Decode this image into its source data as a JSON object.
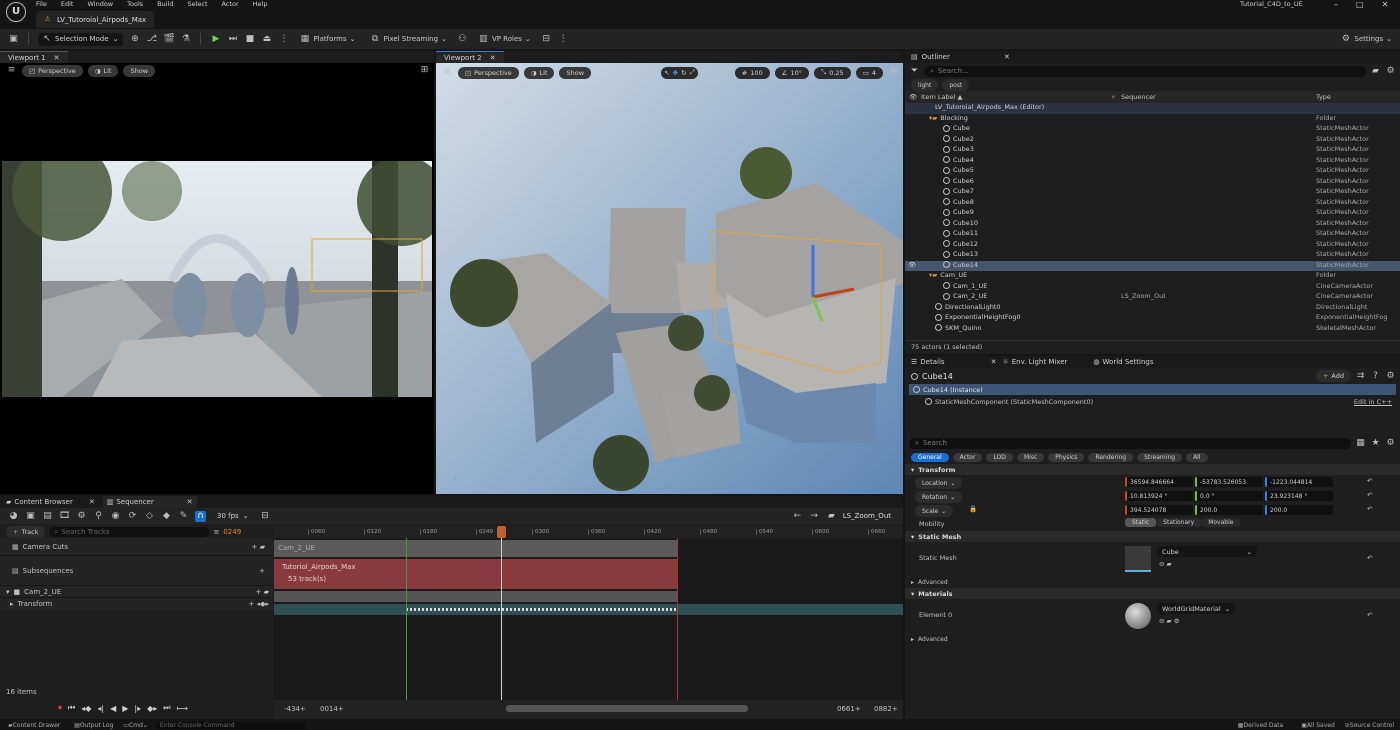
{
  "menu": [
    "File",
    "Edit",
    "Window",
    "Tools",
    "Build",
    "Select",
    "Actor",
    "Help"
  ],
  "level_tab": "LV_Tutoroial_Airpods_Max",
  "project_name": "Tutorial_C4D_to_UE",
  "toolbar": {
    "selection_mode": "Selection Mode",
    "platforms": "Platforms",
    "pixel_streaming": "Pixel Streaming",
    "vp_roles": "VP Roles",
    "settings": "Settings"
  },
  "viewport1": {
    "tab": "Viewport 1",
    "perspective": "Perspective",
    "lit": "Lit",
    "show": "Show"
  },
  "viewport2": {
    "tab": "Viewport 2",
    "perspective": "Perspective",
    "lit": "Lit",
    "show": "Show",
    "grid_size": "100",
    "rot_snap": "10°",
    "scale_snap": "0.25",
    "cam_speed": "4"
  },
  "outliner": {
    "tab": "Outliner",
    "search_placeholder": "Search...",
    "filters": [
      "light",
      "post"
    ],
    "col_label": "Item Label ▲",
    "col_seq": "Sequencer",
    "col_type": "Type",
    "root": "LV_Tutoroial_Airpods_Max (Editor)",
    "rows": [
      {
        "name": "Blocking",
        "type": "Folder",
        "indent": 1,
        "folder": true
      },
      {
        "name": "Cube",
        "type": "StaticMeshActor",
        "indent": 2
      },
      {
        "name": "Cube2",
        "type": "StaticMeshActor",
        "indent": 2
      },
      {
        "name": "Cube3",
        "type": "StaticMeshActor",
        "indent": 2
      },
      {
        "name": "Cube4",
        "type": "StaticMeshActor",
        "indent": 2
      },
      {
        "name": "Cube5",
        "type": "StaticMeshActor",
        "indent": 2
      },
      {
        "name": "Cube6",
        "type": "StaticMeshActor",
        "indent": 2
      },
      {
        "name": "Cube7",
        "type": "StaticMeshActor",
        "indent": 2
      },
      {
        "name": "Cube8",
        "type": "StaticMeshActor",
        "indent": 2
      },
      {
        "name": "Cube9",
        "type": "StaticMeshActor",
        "indent": 2
      },
      {
        "name": "Cube10",
        "type": "StaticMeshActor",
        "indent": 2
      },
      {
        "name": "Cube11",
        "type": "StaticMeshActor",
        "indent": 2
      },
      {
        "name": "Cube12",
        "type": "StaticMeshActor",
        "indent": 2
      },
      {
        "name": "Cube13",
        "type": "StaticMeshActor",
        "indent": 2
      },
      {
        "name": "Cube14",
        "type": "StaticMeshActor",
        "indent": 2,
        "selected": true
      },
      {
        "name": "Cam_UE",
        "type": "Folder",
        "indent": 1,
        "folder": true
      },
      {
        "name": "Cam_1_UE",
        "type": "CineCameraActor",
        "indent": 2
      },
      {
        "name": "Cam_2_UE",
        "type": "CineCameraActor",
        "indent": 2,
        "seq": "LS_Zoom_Out"
      },
      {
        "name": "DirectionalLight0",
        "type": "DirectionalLight",
        "indent": 1
      },
      {
        "name": "ExponentialHeightFog0",
        "type": "ExponentialHeightFog",
        "indent": 1
      },
      {
        "name": "SKM_Quinn",
        "type": "SkeletalMeshActor",
        "indent": 1
      }
    ],
    "footer": "75 actors (1 selected)"
  },
  "details": {
    "tabs": [
      "Details",
      "Env. Light Mixer",
      "World Settings"
    ],
    "actor_name": "Cube14",
    "add_label": "Add",
    "instance": "Cube14 (Instance)",
    "component": "StaticMeshComponent (StaticMeshComponent0)",
    "edit_cpp": "Edit in C++",
    "search_placeholder": "Search",
    "categories": [
      "General",
      "Actor",
      "LOD",
      "Misc",
      "Physics",
      "Rendering",
      "Streaming",
      "All"
    ],
    "transform_label": "Transform",
    "location_label": "Location",
    "location": [
      "36594.846664",
      "-53783.526053",
      "-1223.044814"
    ],
    "rotation_label": "Rotation",
    "rotation": [
      "10.813924 °",
      "0.0 °",
      "23.923148 °"
    ],
    "scale_label": "Scale",
    "scale": [
      "394.524078",
      "200.0",
      "200.0"
    ],
    "mobility_label": "Mobility",
    "mobility_options": [
      "Static",
      "Stationary",
      "Movable"
    ],
    "static_mesh_section": "Static Mesh",
    "static_mesh_label": "Static Mesh",
    "static_mesh_value": "Cube",
    "advanced": "Advanced",
    "materials_section": "Materials",
    "element0_label": "Element 0",
    "material_value": "WorldGridMaterial",
    "advanced2": "Advanced"
  },
  "sequencer": {
    "tabs": [
      "Content Browser",
      "Sequencer"
    ],
    "fps": "30 fps",
    "sequence_name": "LS_Zoom_Out",
    "track_btn": "Track",
    "search_placeholder": "Search Tracks",
    "current_frame": "0249",
    "tracks": [
      {
        "name": "Camera Cuts",
        "section": "Cam_2_UE"
      },
      {
        "name": "Subsequences",
        "section": "Tutoriol_Airpods_Max",
        "sub": "53 track(s)"
      },
      {
        "name": "Cam_2_UE"
      },
      {
        "name": "Transform"
      }
    ],
    "ruler": [
      "0060",
      "0120",
      "0180",
      "0249",
      "0300",
      "0360",
      "0420",
      "0480",
      "0540",
      "0600",
      "0660"
    ],
    "items_count": "16 items",
    "range_start": "-434+",
    "range_in": "0014+",
    "range_out": "0661+",
    "range_end": "0882+"
  },
  "statusbar": {
    "content_drawer": "Content Drawer",
    "output_log": "Output Log",
    "cmd": "Cmd",
    "console_placeholder": "Enter Console Command",
    "derived_data": "Derived Data",
    "all_saved": "All Saved",
    "source_control": "Source Control"
  }
}
